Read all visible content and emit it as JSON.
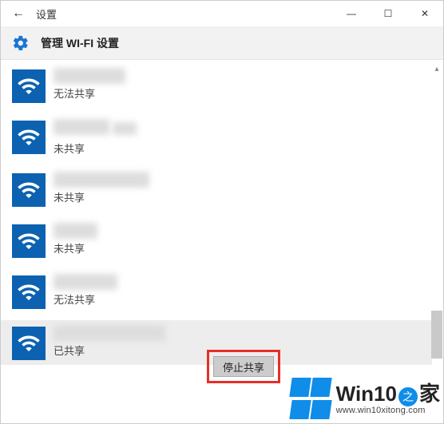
{
  "window": {
    "title": "设置",
    "minimize": "—",
    "maximize": "☐",
    "close": "✕",
    "back": "←"
  },
  "header": {
    "title": "管理 WI-FI 设置"
  },
  "networks": [
    {
      "status": "无法共享"
    },
    {
      "status": "未共享"
    },
    {
      "status": "未共享"
    },
    {
      "status": "未共享"
    },
    {
      "status": "无法共享"
    },
    {
      "status": "已共享",
      "selected": true
    }
  ],
  "action": {
    "stop_share": "停止共享"
  },
  "watermark": {
    "brand_pre": "Win10",
    "brand_zhi": "之",
    "brand_post": "家",
    "url": "www.win10xitong.com"
  }
}
